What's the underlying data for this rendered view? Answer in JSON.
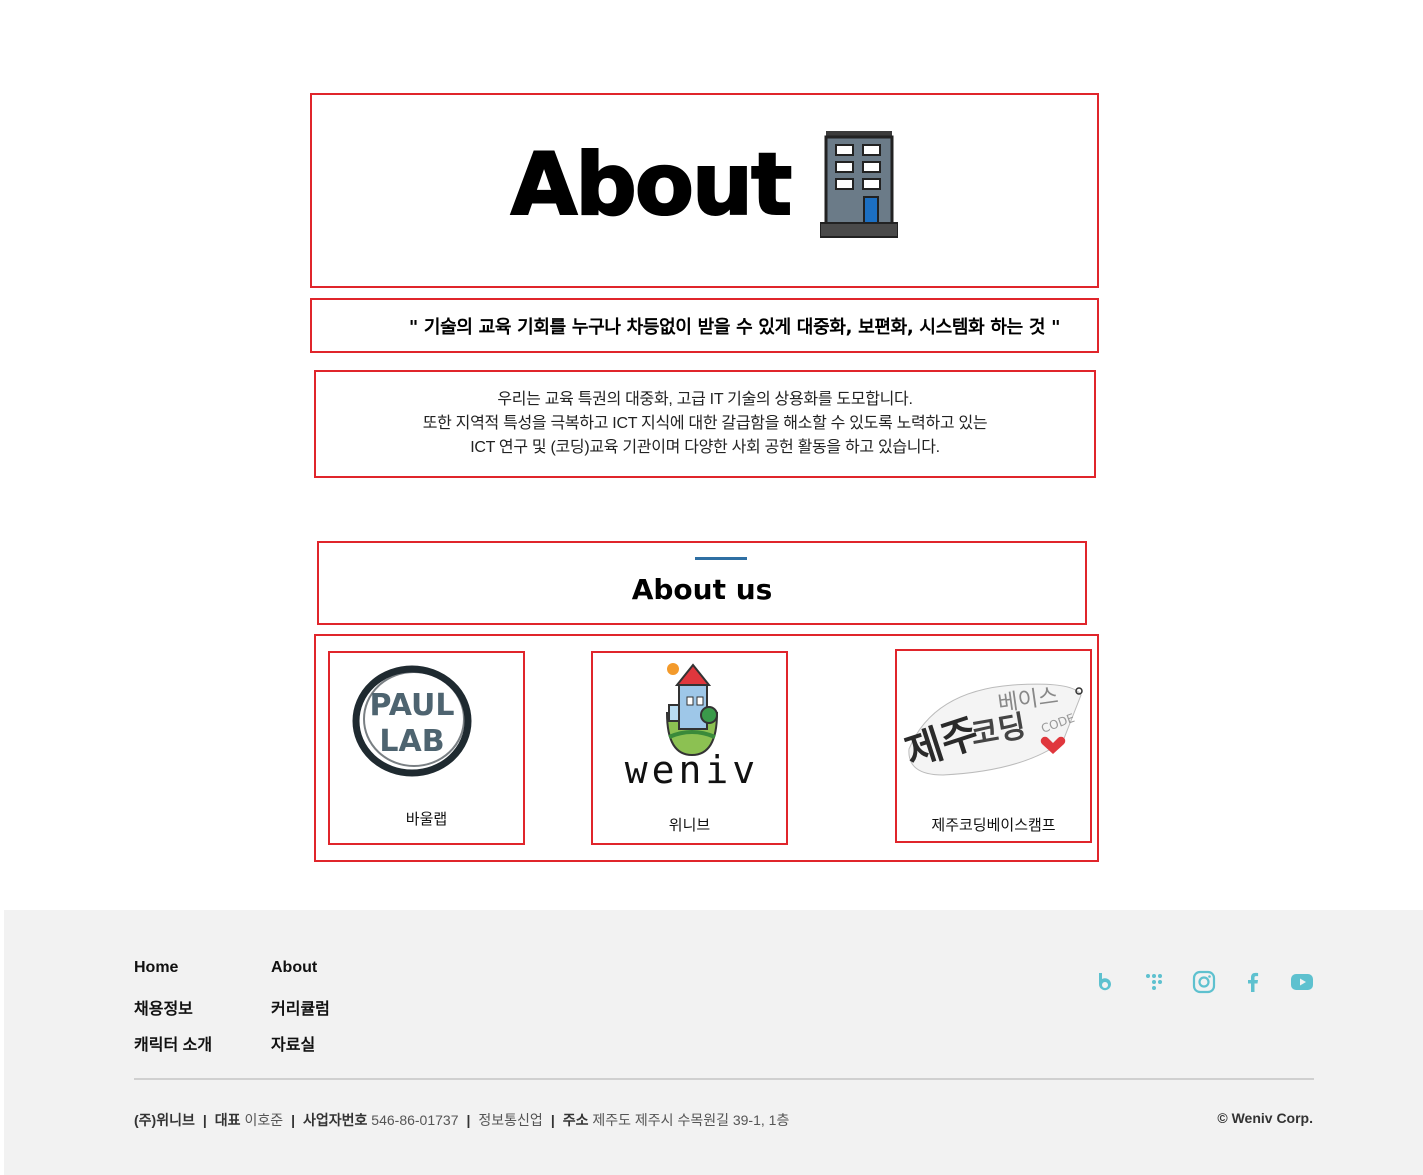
{
  "hero": {
    "title": "About",
    "slogan": "\" 기술의 교육 기회를 누구나 차등없이 받을 수 있게 대중화, 보편화, 시스템화 하는 것 \"",
    "description": [
      "우리는 교육 특권의 대중화, 고급 IT 기술의 상용화를 도모합니다.",
      "또한 지역적 특성을 극복하고 ICT 지식에 대한 갈급함을 해소할 수 있도록 노력하고 있는",
      "ICT 연구 및 (코딩)교육 기관이며 다양한 사회 공헌 활동을 하고 있습니다."
    ]
  },
  "about_us": {
    "title": "About us",
    "partners": [
      {
        "name": "바울랩",
        "logo_text_1": "PAUL",
        "logo_text_2": "LAB"
      },
      {
        "name": "위니브",
        "logo_text": "weniv"
      },
      {
        "name": "제주코딩베이스캠프",
        "logo_text": "CODE"
      }
    ]
  },
  "footer": {
    "links": [
      "Home",
      "채용정보",
      "캐릭터 소개",
      "About",
      "커리큘럼",
      "자료실"
    ],
    "social": [
      "blog-icon",
      "weniv-dots-icon",
      "instagram-icon",
      "facebook-icon",
      "youtube-icon"
    ],
    "company": {
      "name": "(주)위니브",
      "ceo_label": "대표",
      "ceo": "이호준",
      "biz_label": "사업자번호",
      "biz_no": "546-86-01737",
      "industry": "정보통신업",
      "addr_label": "주소",
      "address": "제주도 제주시 수목원길 39-1, 1층"
    },
    "copyright": "© Weniv Corp."
  },
  "colors": {
    "border": "#e0252b",
    "accent": "#2f6fa3",
    "social": "#5ec1cf",
    "footer_bg": "#f2f2f2"
  }
}
